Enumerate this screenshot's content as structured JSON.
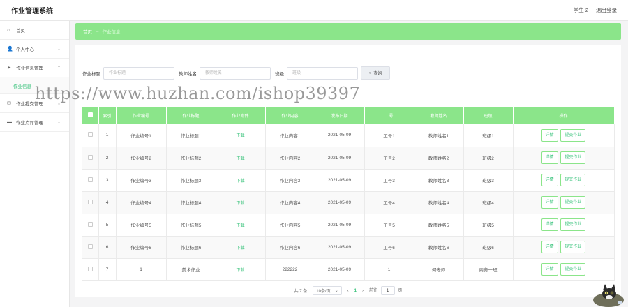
{
  "app": {
    "title": "作业管理系统"
  },
  "header": {
    "user_label": "学生 2",
    "logout_label": "退出登录"
  },
  "sidebar": {
    "items": [
      {
        "label": "首页",
        "icon": "home-icon"
      },
      {
        "label": "个人中心",
        "icon": "user-icon"
      },
      {
        "label": "作业信息管理",
        "icon": "send-icon"
      },
      {
        "label": "作业信息",
        "sub": true
      },
      {
        "label": "作业提交管理",
        "icon": "mail-icon"
      },
      {
        "label": "作业点评管理",
        "icon": "monitor-icon"
      }
    ]
  },
  "breadcrumb": {
    "home": "首页",
    "separator": "→",
    "current": "作业信息"
  },
  "search": {
    "title_label": "作业标题",
    "title_placeholder": "作业标题",
    "teacher_label": "教师姓名",
    "teacher_placeholder": "教师姓名",
    "class_label": "班级",
    "class_placeholder": "班级",
    "button_label": "查询"
  },
  "table": {
    "headers": [
      "",
      "索引",
      "作业编号",
      "作业标题",
      "作业附件",
      "作业内容",
      "发布日期",
      "工号",
      "教师姓名",
      "班级",
      "操作"
    ],
    "rows": [
      {
        "idx": "1",
        "code": "作业编号1",
        "title": "作业标题1",
        "file": "下载",
        "content": "作业内容1",
        "date": "2021-05-09",
        "job": "工号1",
        "teacher": "教师姓名1",
        "cls": "班级1"
      },
      {
        "idx": "2",
        "code": "作业编号2",
        "title": "作业标题2",
        "file": "下载",
        "content": "作业内容2",
        "date": "2021-05-09",
        "job": "工号2",
        "teacher": "教师姓名2",
        "cls": "班级2"
      },
      {
        "idx": "3",
        "code": "作业编号3",
        "title": "作业标题3",
        "file": "下载",
        "content": "作业内容3",
        "date": "2021-05-09",
        "job": "工号3",
        "teacher": "教师姓名3",
        "cls": "班级3"
      },
      {
        "idx": "4",
        "code": "作业编号4",
        "title": "作业标题4",
        "file": "下载",
        "content": "作业内容4",
        "date": "2021-05-09",
        "job": "工号4",
        "teacher": "教师姓名4",
        "cls": "班级4"
      },
      {
        "idx": "5",
        "code": "作业编号5",
        "title": "作业标题5",
        "file": "下载",
        "content": "作业内容5",
        "date": "2021-05-09",
        "job": "工号5",
        "teacher": "教师姓名5",
        "cls": "班级5"
      },
      {
        "idx": "6",
        "code": "作业编号6",
        "title": "作业标题6",
        "file": "下载",
        "content": "作业内容6",
        "date": "2021-05-09",
        "job": "工号6",
        "teacher": "教师姓名6",
        "cls": "班级6"
      },
      {
        "idx": "7",
        "code": "1",
        "title": "美术作业",
        "file": "下载",
        "content": "222222",
        "date": "2021-05-09",
        "job": "1",
        "teacher": "何老师",
        "cls": "商务一班"
      }
    ],
    "detail_label": "详情",
    "submit_label": "提交作业"
  },
  "pagination": {
    "total": "共 7 条",
    "page_size": "10条/页",
    "prev": "‹",
    "current_page": "1",
    "next": "›",
    "goto_label": "前往",
    "goto_value": "1",
    "page_unit": "页"
  },
  "watermark": "https://www.huzhan.com/ishop39397",
  "colors": {
    "accent": "#8be58a",
    "accent_text": "#3ac37c"
  }
}
